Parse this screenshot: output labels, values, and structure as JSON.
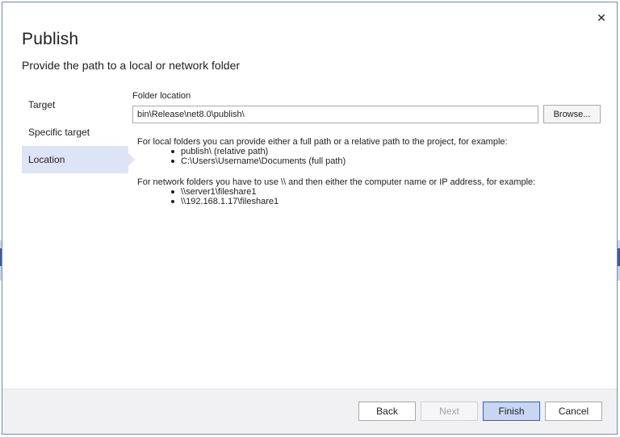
{
  "dialog": {
    "title": "Publish",
    "subtitle": "Provide the path to a local or network folder",
    "close_glyph": "✕"
  },
  "nav": {
    "items": [
      {
        "label": "Target",
        "active": false
      },
      {
        "label": "Specific target",
        "active": false
      },
      {
        "label": "Location",
        "active": true
      }
    ]
  },
  "location": {
    "field_label": "Folder location",
    "path_value": "bin\\Release\\net8.0\\publish\\",
    "browse_label": "Browse..."
  },
  "help": {
    "local_intro": "For local folders you can provide either a full path or a relative path to the project, for example:",
    "local_examples": [
      "publish\\ (relative path)",
      "C:\\Users\\Username\\Documents (full path)"
    ],
    "network_intro": "For network folders you have to use \\\\ and then either the computer name or IP address, for example:",
    "network_examples": [
      "\\\\server1\\fileshare1",
      "\\\\192.168.1.17\\fileshare1"
    ]
  },
  "footer": {
    "back_label": "Back",
    "next_label": "Next",
    "finish_label": "Finish",
    "cancel_label": "Cancel"
  },
  "colors": {
    "accent_selected": "#dce4f6",
    "primary_button": "#c9d6f2",
    "primary_border": "#3c5fb8"
  }
}
